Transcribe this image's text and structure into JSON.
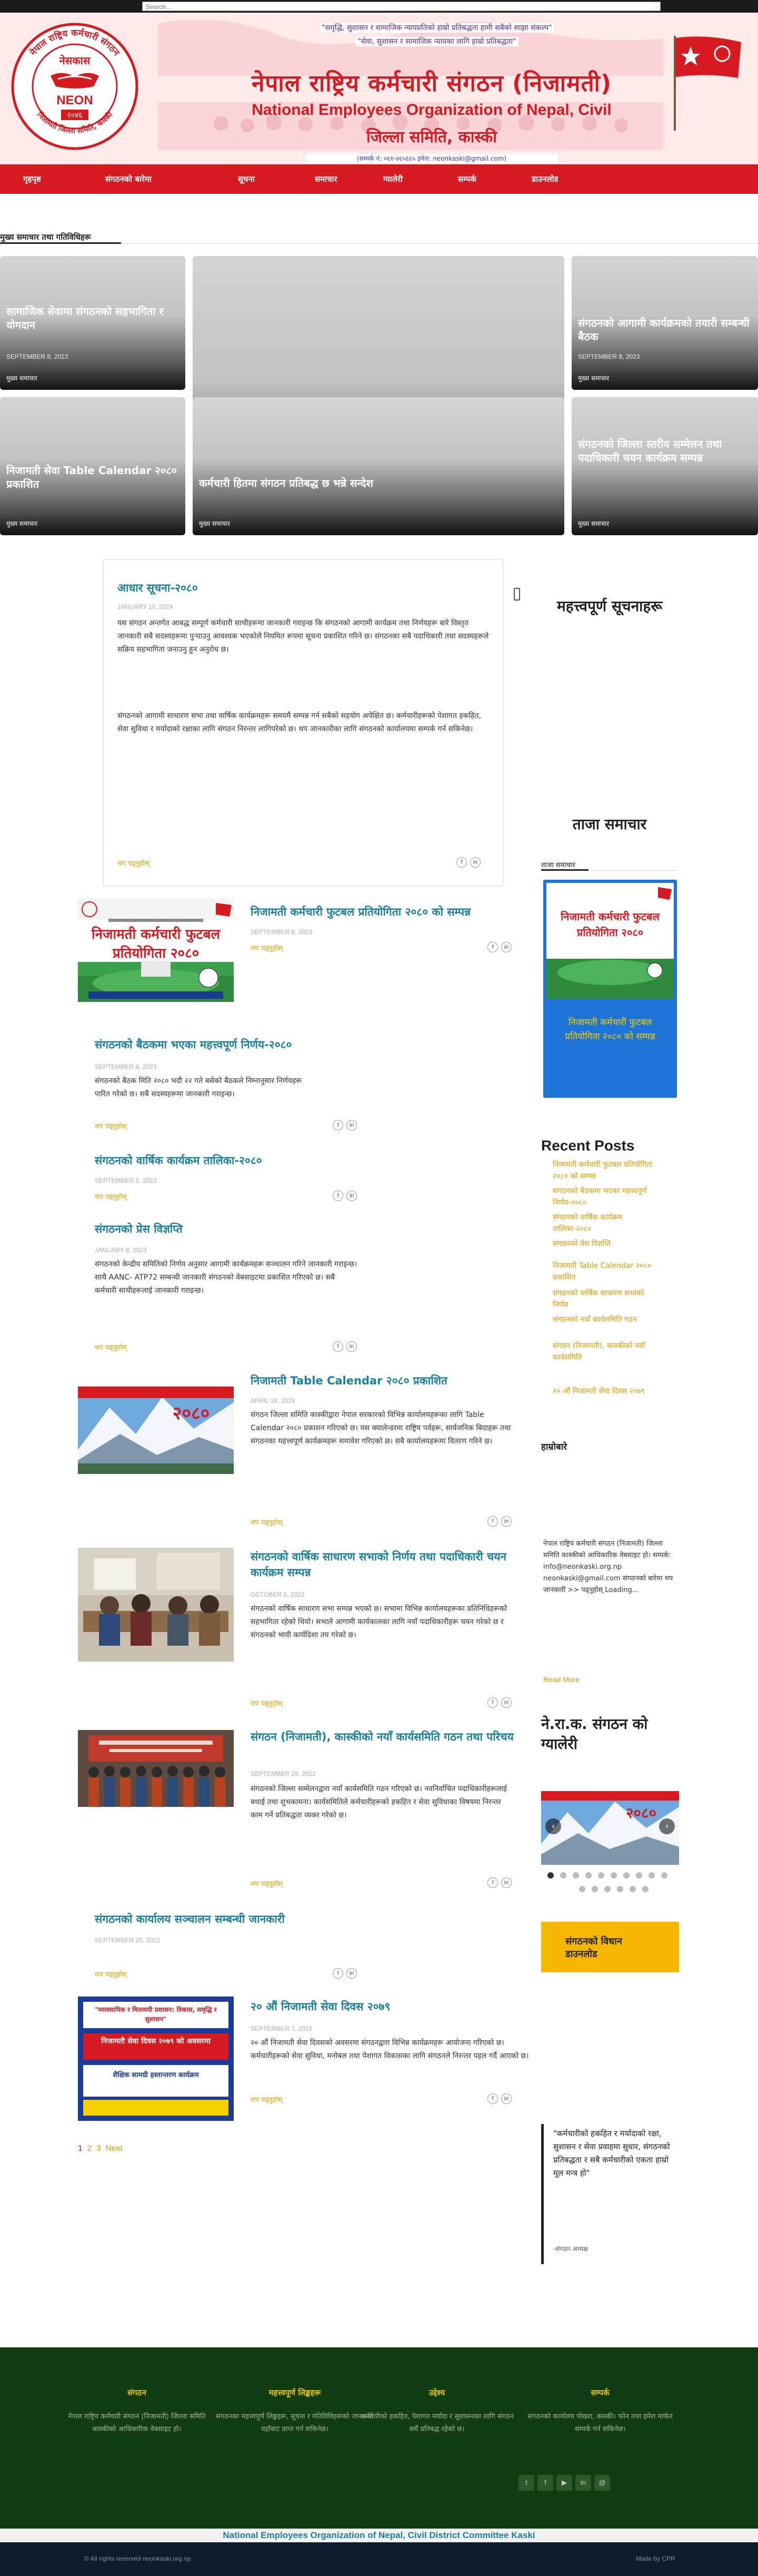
{
  "topbar": {
    "search_placeholder": "Search..."
  },
  "header": {
    "logo_ring_text": "नेपाल राष्ट्रिय कर्मचारी संगठन",
    "logo_bottom_text": "निजामती जिल्ला समिति, कास्की",
    "logo_word_np": "नेसकास",
    "logo_word_en": "NEON",
    "logo_year": "२०४६",
    "slogan_line1": "\"समृद्धि, सुशासन र सामाजिक न्यायप्रतिको हाम्रो प्रतिबद्धता हामी सबैको साझा संकल्प\"",
    "slogan_line2": "\"सेवा, सुशासन र सामाजिक न्यायका लागि हाम्रो प्रतिबद्धता\"",
    "org_name_np": "नेपाल राष्ट्रिय कर्मचारी संगठन (निजामती)",
    "org_name_en": "National Employees Organization of Nepal, Civil",
    "org_sub": "जिल्ला समिति, कास्की",
    "contact": "(सम्पर्क नं: ०६१-४६५६६५ इमेल: neonkaski@gmail.com)"
  },
  "nav": {
    "items": [
      "गृहपृष्ठ",
      "संगठनको बारेमा",
      "सूचना",
      "समाचार",
      "ग्यालेरी",
      "सम्पर्क",
      "डाउनलोड"
    ]
  },
  "featured": {
    "section_title": "मुख्य समाचार तथा गतिविधिहरू",
    "tiles": [
      {
        "title": "सामाजिक सेवामा संगठनको सहभागिता र योगदान",
        "date": "SEPTEMBER 8, 2023",
        "tag": "मुख्य समाचार"
      },
      {
        "title": "",
        "date": "",
        "tag": ""
      },
      {
        "title": "संगठनको आगामी कार्यक्रमको तयारी सम्बन्धी बैठक",
        "date": "SEPTEMBER 8, 2023",
        "tag": "मुख्य समाचार"
      },
      {
        "title": "निजामती सेवा Table Calendar २०८० प्रकाशित",
        "date": "",
        "tag": "मुख्य समाचार"
      },
      {
        "title": "कर्मचारी हितमा संगठन प्रतिबद्ध छ भन्ने सन्देश",
        "date": "",
        "tag": "मुख्य समाचार"
      },
      {
        "title": "संगठनको जिल्ला स्तरीय सम्मेलन तथा पदाधिकारी चयन कार्यक्रम सम्पन्न",
        "date": "",
        "tag": "मुख्य समाचार"
      }
    ]
  },
  "posts": [
    {
      "title": "आधार सूचना-२०८०",
      "date": "JANUARY 10, 2024",
      "excerpt": "यस संगठन अन्तर्गत आबद्ध सम्पूर्ण कर्मचारी साथीहरूमा जानकारी गराइन्छ कि संगठनको आगामी कार्यक्रम तथा निर्णयहरू बारे विस्तृत जानकारी सबै सदस्यहरूमा पुर्‍याउनु आवश्यक भएकोले नियमित रूपमा सूचना प्रकाशित गरिने छ। संगठनका सबै पदाधिकारी तथा सदस्यहरूले सक्रिय सहभागिता जनाउनु हुन अनुरोध छ।",
      "excerpt2": "संगठनको आगामी साधारण सभा तथा वार्षिक कार्यक्रमहरू समयमै सम्पन्न गर्न सबैको सहयोग अपेक्षित छ। कर्मचारीहरूको पेशागत हकहित, सेवा सुविधा र मर्यादाको रक्षाका लागि संगठन निरन्तर लागिपरेको छ। थप जानकारीका लागि संगठनको कार्यालयमा सम्पर्क गर्न सकिनेछ।",
      "read_more": "थप पढ्नुहोस्"
    },
    {
      "title": "निजामती कर्मचारी फुटबल प्रतियोगिता २०८० को सम्पन्न",
      "date": "SEPTEMBER 8, 2023",
      "excerpt": "",
      "read_more": "थप पढ्नुहोस्"
    },
    {
      "title": "संगठनको बैठकमा भएका महत्त्वपूर्ण निर्णय-२०८०",
      "date": "SEPTEMBER 8, 2023",
      "excerpt": "संगठनको बैठक मिति २०८० भदौ २२ गते बसेको बैठकले निम्नानुसार निर्णयहरू पारित गरेको छ। सबै सदस्यहरूमा जानकारी गराइन्छ।",
      "read_more": "थप पढ्नुहोस्"
    },
    {
      "title": "संगठनको वार्षिक कार्यक्रम तालिका-२०८०",
      "date": "SEPTEMBER 5, 2023",
      "excerpt": "",
      "read_more": "थप पढ्नुहोस्"
    },
    {
      "title": "संगठनको प्रेस विज्ञप्ति",
      "date": "JANUARY 8, 2023",
      "excerpt": "संगठनको केन्द्रीय समितिको निर्णय अनुसार आगामी कार्यक्रमहरू सञ्चालन गरिने जानकारी गराइन्छ। साथै AANC- ATP72 सम्बन्धी जानकारी संगठनको वेबसाइटमा प्रकाशित गरिएको छ। सबै कर्मचारी साथीहरूलाई जानकारी गराइन्छ।",
      "read_more": "थप पढ्नुहोस्"
    },
    {
      "title": "निजामती Table Calendar २०८० प्रकाशित",
      "date": "APRIL 19, 2023",
      "excerpt": "संगठन जिल्ला समिति कास्कीद्वारा नेपाल सरकारको विभिन्न कार्यालयहरूका लागि Table Calendar २०८० प्रकाशन गरिएको छ। यस क्यालेन्डरमा राष्ट्रिय पर्वहरू, सार्वजनिक बिदाहरू तथा संगठनका महत्त्वपूर्ण कार्यक्रमहरू समावेश गरिएको छ। सबै कार्यालयहरूमा वितरण गरिने छ।",
      "read_more": "थप पढ्नुहोस्"
    },
    {
      "title": "संगठनको वार्षिक साधारण सभाको निर्णय तथा पदाधिकारी चयन कार्यक्रम सम्पन्न",
      "date": "OCTOBER 5, 2022",
      "excerpt": "संगठनको वार्षिक साधारण सभा सम्पन्न भएको छ। सभामा विभिन्न कार्यालयहरूका प्रतिनिधिहरूको सहभागिता रहेको थियो। सभाले आगामी कार्यकालका लागि नयाँ पदाधिकारीहरू चयन गरेको छ र संगठनको भावी कार्यदिशा तय गरेको छ।",
      "read_more": "थप पढ्नुहोस्"
    },
    {
      "title": "संगठन (निजामती), कास्कीको नयाँ कार्यसमिति गठन तथा परिचय",
      "date": "SEPTEMBER 29, 2022",
      "excerpt": "संगठनको जिल्ला सम्मेलनद्वारा नयाँ कार्यसमिति गठन गरिएको छ। नवनिर्वाचित पदाधिकारीहरूलाई बधाई तथा शुभकामना। कार्यसमितिले कर्मचारीहरूको हकहित र सेवा सुविधाका विषयमा निरन्तर काम गर्ने प्रतिबद्धता व्यक्त गरेको छ।",
      "read_more": "थप पढ्नुहोस्"
    },
    {
      "title": "संगठनको कार्यालय सञ्चालन सम्बन्धी जानकारी",
      "date": "SEPTEMBER 20, 2022",
      "excerpt": "",
      "read_more": "थप पढ्नुहोस्"
    },
    {
      "title": "२० औं निजामती सेवा दिवस २०७९",
      "date": "SEPTEMBER 7, 2022",
      "excerpt": "२० औं निजामती सेवा दिवसको अवसरमा संगठनद्वारा विभिन्न कार्यक्रमहरू आयोजना गरिएको छ। कर्मचारीहरूको सेवा सुविधा, मनोबल तथा पेशागत विकासका लागि संगठनले निरन्तर पहल गर्दै आएको छ।",
      "read_more": "थप पढ्नुहोस्"
    }
  ],
  "thumbs": {
    "football_title": "निजामती कर्मचारी फुटबल",
    "football_sub": "प्रतियोगिता २०८०",
    "calendar_year": "२०८०",
    "civil_day_title": "निजामती सेवा दिवस २०७९ को अवसरमा",
    "civil_day_sub": "शैक्षिक सामग्री हस्तान्तरण कार्यक्रम",
    "civil_day_banner": "\"व्यावसायिक र मितव्ययी प्रशासन: विकास, समृद्धि र सुशासन\""
  },
  "pagination": {
    "p1": "1",
    "p2": "2",
    "p3": "3",
    "next": "Next"
  },
  "sidebar": {
    "notice_heading": "महत्त्वपूर्ण सूचनाहरू",
    "news_heading": "ताजा समाचार",
    "news_tab": "ताजा समाचार",
    "poster_caption": "निजामती कर्मचारी फुटबल प्रतियोगिता २०८० को सम्पन्न",
    "recent_heading": "Recent Posts",
    "recent_posts": [
      "निजामती कर्मचारी फुटबल प्रतियोगिता २०८० को सम्पन्न",
      "संगठनको बैठकमा भएका महत्त्वपूर्ण निर्णय-२०८०",
      "संगठनको वार्षिक कार्यक्रम तालिका-२०८०",
      "संगठनको प्रेस विज्ञप्ति",
      "निजामती Table Calendar २०८० प्रकाशित",
      "संगठनको वार्षिक साधारण सभाको निर्णय",
      "संगठनको नयाँ कार्यसमिति गठन",
      "संगठन (निजामती), कास्कीको नयाँ कार्यसमिति",
      "२० औं निजामती सेवा दिवस २०७९"
    ],
    "about_heading": "हाम्रोबारे",
    "about_text": "नेपाल राष्ट्रिय कर्मचारी संगठन (निजामती) जिल्ला समिति कास्कीको आधिकारिक वेबसाइट हो। सम्पर्क: info@neonkaski.org.np neonkaski@gmail.com संगठनको बारेमा थप जानकारी >> पढ्नुहोस् Loading...",
    "about_read_more": "Read More",
    "gallery_heading": "ने.रा.क. संगठन को ग्यालेरी",
    "gallery_year": "२०८०",
    "yellow_box": "संगठनको विधान डाउनलोड",
    "quote": "\"कर्मचारीको हकहित र मर्यादाको रक्षा, सुशासन र सेवा प्रवाहमा सुधार, संगठनको प्रतिबद्धता र सबै कर्मचारीको एकता हाम्रो मूल मन्त्र हो\"",
    "quote_author": "-संगठन अध्यक्ष"
  },
  "footer": {
    "cols": [
      {
        "heading": "संगठन",
        "text": "नेपाल राष्ट्रिय कर्मचारी संगठन (निजामती) जिल्ला समिति कास्कीको आधिकारिक वेबसाइट हो।"
      },
      {
        "heading": "महत्त्वपूर्ण लिङ्कहरू",
        "text": "संगठनका महत्त्वपूर्ण लिङ्कहरू, सूचना र गतिविधिहरूको जानकारी यहाँबाट प्राप्त गर्न सकिनेछ।"
      },
      {
        "heading": "उद्देश्य",
        "text": "कर्मचारीको हकहित, पेशागत मर्यादा र सुशासनका लागि संगठन सधैं प्रतिबद्ध रहेको छ।"
      },
      {
        "heading": "सम्पर्क",
        "text": "संगठनको कार्यालय पोखरा, कास्की। फोन तथा इमेल मार्फत सम्पर्क गर्न सकिनेछ।"
      }
    ],
    "social": [
      "t",
      "f",
      "▶",
      "in",
      "@"
    ],
    "name_strip": "National Employees Organization of Nepal, Civil District Committee Kaski",
    "copyright": "© All rights reserved neonkaski.org.np",
    "made_by": "Made by CPR"
  },
  "colors": {
    "brand_red": "#d71920",
    "link_blue": "#1a7fa0",
    "accent_gold": "#e09a00",
    "footer_green": "#123d12"
  }
}
